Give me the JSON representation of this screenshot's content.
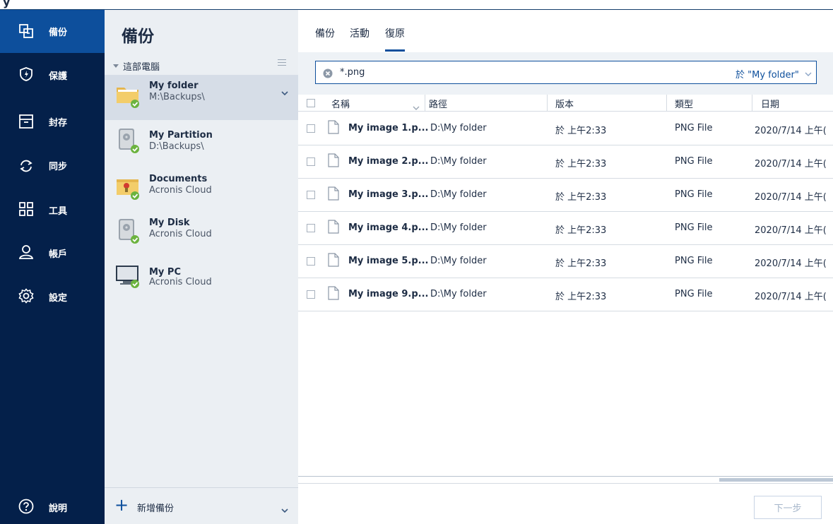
{
  "window": {
    "title_fragment": "y"
  },
  "nav": {
    "items": [
      {
        "label": "備份",
        "icon": "backup-icon"
      },
      {
        "label": "保護",
        "icon": "shield-icon"
      },
      {
        "label": "封存",
        "icon": "archive-icon"
      },
      {
        "label": "同步",
        "icon": "sync-icon"
      },
      {
        "label": "工具",
        "icon": "tools-grid-icon"
      },
      {
        "label": "帳戶",
        "icon": "account-icon"
      },
      {
        "label": "設定",
        "icon": "gear-icon"
      }
    ],
    "help_label": "說明",
    "active_index": 0
  },
  "backups": {
    "title": "備份",
    "section_label": "這部電腦",
    "items": [
      {
        "name": "My folder",
        "location": "M:\\Backups\\",
        "icon": "folder-icon"
      },
      {
        "name": "My Partition",
        "location": "D:\\Backups\\",
        "icon": "disk-icon"
      },
      {
        "name": "Documents",
        "location": "Acronis Cloud",
        "icon": "document-folder-icon"
      },
      {
        "name": "My Disk",
        "location": "Acronis Cloud",
        "icon": "disk-icon"
      },
      {
        "name": "My PC",
        "location": "Acronis Cloud",
        "icon": "computer-icon"
      }
    ],
    "add_label": "新增備份"
  },
  "tabs": [
    {
      "label": "備份"
    },
    {
      "label": "活動"
    },
    {
      "label": "復原"
    }
  ],
  "active_tab": 2,
  "search": {
    "value": "*.png",
    "scope": "於 \"My folder\""
  },
  "table": {
    "headers": [
      "名稱",
      "路徑",
      "版本",
      "類型",
      "日期"
    ],
    "rows": [
      {
        "name": "My image 1.p...",
        "path": "D:\\My folder",
        "version": "於 上午2:33",
        "type": "PNG File",
        "date": "2020/7/14 上午("
      },
      {
        "name": "My image 2.p...",
        "path": "D:\\My folder",
        "version": "於 上午2:33",
        "type": "PNG File",
        "date": "2020/7/14 上午("
      },
      {
        "name": "My image 3.p...",
        "path": "D:\\My folder",
        "version": "於 上午2:33",
        "type": "PNG File",
        "date": "2020/7/14 上午("
      },
      {
        "name": "My image 4.p...",
        "path": "D:\\My folder",
        "version": "於 上午2:33",
        "type": "PNG File",
        "date": "2020/7/14 上午("
      },
      {
        "name": "My image 5.p...",
        "path": "D:\\My folder",
        "version": "於 上午2:33",
        "type": "PNG File",
        "date": "2020/7/14 上午("
      },
      {
        "name": "My image 9.p...",
        "path": "D:\\My folder",
        "version": "於 上午2:33",
        "type": "PNG File",
        "date": "2020/7/14 上午("
      }
    ]
  },
  "footer": {
    "next_label": "下一步"
  },
  "colors": {
    "nav_bg": "#04204a",
    "nav_active": "#0d4f9c",
    "accent": "#0d4f9c",
    "status_ok": "#6cb33f"
  }
}
